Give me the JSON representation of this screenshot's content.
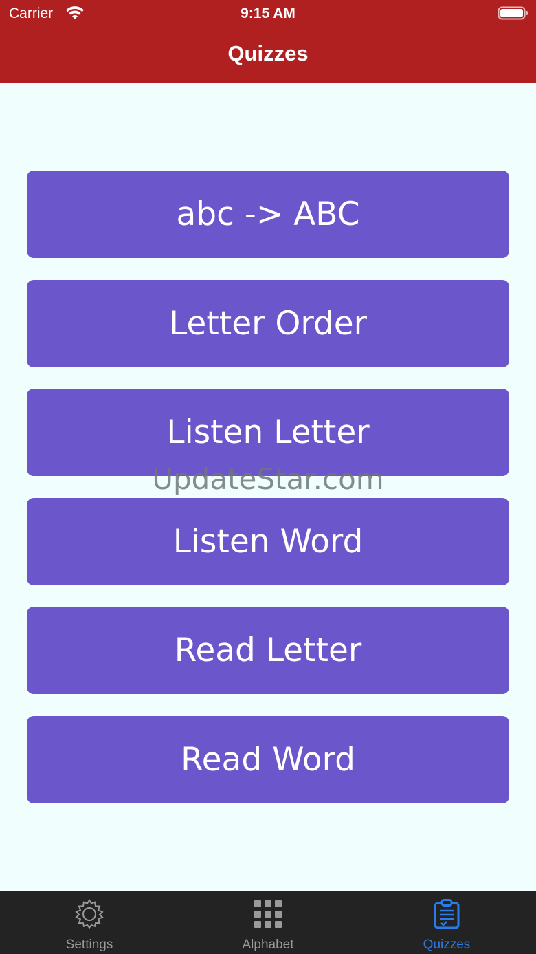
{
  "status_bar": {
    "carrier": "Carrier",
    "time": "9:15 AM",
    "wifi_icon": "wifi-icon",
    "battery_icon": "battery-icon"
  },
  "header": {
    "title": "Quizzes",
    "background_color": "#b02021"
  },
  "quizzes": [
    {
      "label": "abc -> ABC"
    },
    {
      "label": "Letter Order"
    },
    {
      "label": "Listen Letter"
    },
    {
      "label": "Listen Word"
    },
    {
      "label": "Read Letter"
    },
    {
      "label": "Read Word"
    }
  ],
  "button_color": "#6b56cb",
  "watermark": "UpdateStar.com",
  "tab_bar": {
    "active_color": "#2a7de8",
    "inactive_color": "#9a9a9a",
    "tabs": [
      {
        "label": "Settings",
        "icon": "gear-icon",
        "active": false
      },
      {
        "label": "Alphabet",
        "icon": "grid-icon",
        "active": false
      },
      {
        "label": "Quizzes",
        "icon": "clipboard-icon",
        "active": true
      }
    ]
  }
}
